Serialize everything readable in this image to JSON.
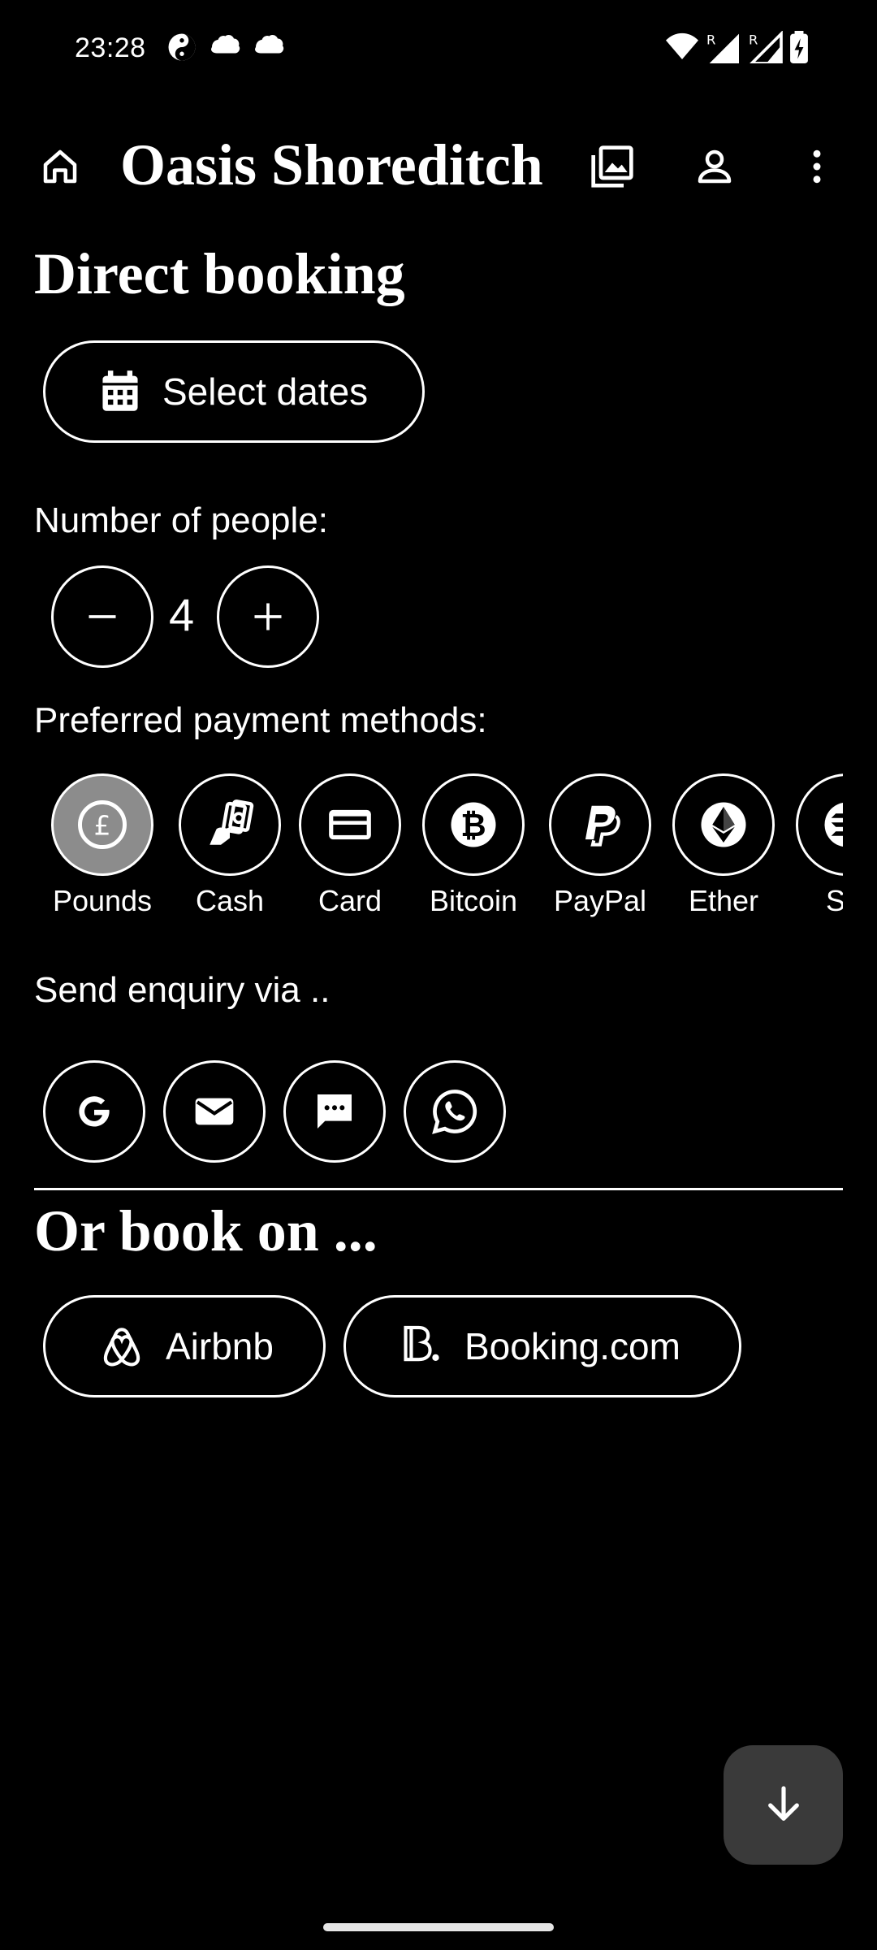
{
  "status_bar": {
    "time": "23:28",
    "left_icons": [
      "yin-yang-icon",
      "notification-icon",
      "notification-icon"
    ],
    "right_icons": [
      "wifi-icon",
      "signal-roaming-icon",
      "signal-roaming-icon",
      "battery-charging-icon"
    ]
  },
  "app_bar": {
    "title": "Oasis Shoreditch",
    "home_icon": "home-icon",
    "gallery_icon": "photo-library-icon",
    "account_icon": "person-icon",
    "menu_icon": "more-vert-icon"
  },
  "booking": {
    "heading": "Direct booking",
    "select_dates_label": "Select dates",
    "people_label": "Number of people:",
    "people_count": "4",
    "payment_label": "Preferred payment methods:",
    "payment_methods": [
      {
        "label": "Pounds",
        "icon": "pound-icon",
        "selected": true
      },
      {
        "label": "Cash",
        "icon": "cash-icon",
        "selected": false
      },
      {
        "label": "Card",
        "icon": "credit-card-icon",
        "selected": false
      },
      {
        "label": "Bitcoin",
        "icon": "bitcoin-icon",
        "selected": false
      },
      {
        "label": "PayPal",
        "icon": "paypal-icon",
        "selected": false
      },
      {
        "label": "Ether",
        "icon": "ethereum-icon",
        "selected": false
      },
      {
        "label": "Sol",
        "icon": "solana-icon",
        "selected": false
      }
    ],
    "enquiry_label": "Send enquiry via ..",
    "enquiry_channels": [
      "google-icon",
      "email-icon",
      "sms-icon",
      "whatsapp-icon"
    ]
  },
  "external": {
    "heading": "Or book on ...",
    "airbnb_label": "Airbnb",
    "booking_label": "Booking.com"
  },
  "colors": {
    "background": "#000000",
    "foreground": "#ffffff",
    "selected_chip": "#8c8c8c",
    "fab_background": "#3a3a3a"
  }
}
